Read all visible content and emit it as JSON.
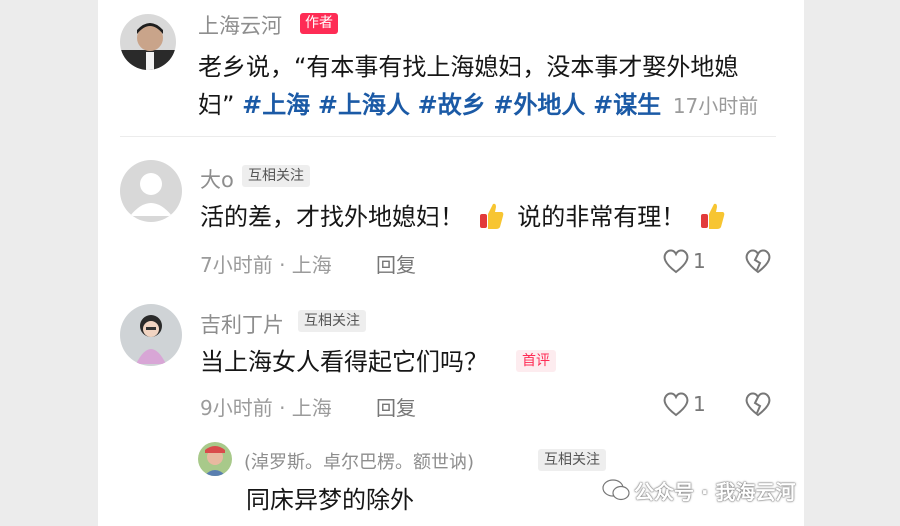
{
  "post": {
    "author_name": "上海云河",
    "author_badge": "作者",
    "text_line1": "老乡说，“有本事有找上海媳妇，没本事才娶外地媳",
    "text_line2_start": "妇”",
    "tags": [
      "#上海",
      "#上海人",
      "#故乡",
      "#外地人",
      "#谋生"
    ],
    "time": "17小时前"
  },
  "comments": [
    {
      "name": "大o",
      "follow_badge": "互相关注",
      "text_a": "活的差，才找外地媳妇！",
      "text_b": "说的非常有理！",
      "emoji_icon": "thumbs-up",
      "meta": "7小时前 · 上海",
      "reply": "回复",
      "likes": "1"
    },
    {
      "name": "吉利丁片",
      "follow_badge": "互相关注",
      "text": "当上海女人看得起它们吗？",
      "first_badge": "首评",
      "meta": "9小时前 · 上海",
      "reply": "回复",
      "likes": "1"
    }
  ],
  "sub_reply": {
    "name": "(淖罗斯。卓尔巴楞。额世讷)",
    "follow_badge": "互相关注",
    "text": "同床异梦的除外"
  },
  "watermark": "公众号 · 我海云河",
  "colors": {
    "accent_red": "#fe2c55",
    "tag_blue": "#1b5aa6"
  }
}
